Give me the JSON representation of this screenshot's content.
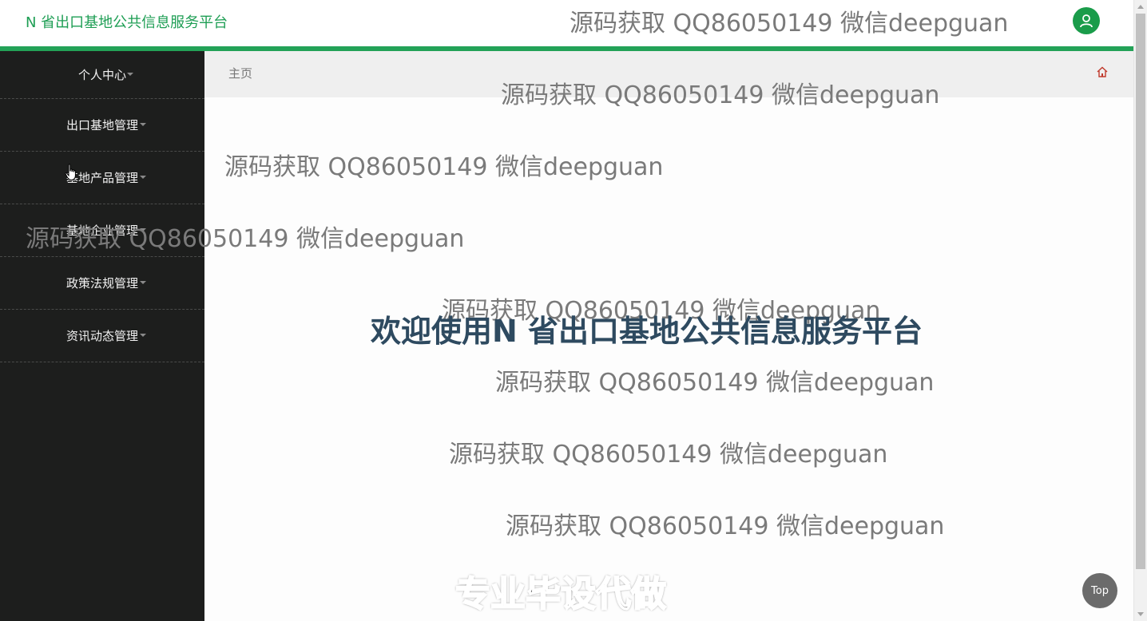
{
  "header": {
    "app_title": "N 省出口基地公共信息服务平台",
    "avatar_icon": "user-icon"
  },
  "sidebar": {
    "items": [
      {
        "label": "个人中心"
      },
      {
        "label": "出口基地管理"
      },
      {
        "label": "基地产品管理"
      },
      {
        "label": "基地企业管理"
      },
      {
        "label": "政策法规管理"
      },
      {
        "label": "资讯动态管理"
      }
    ]
  },
  "breadcrumb": {
    "label": "主页",
    "home_icon": "home-icon"
  },
  "main": {
    "welcome": "欢迎使用N 省出口基地公共信息服务平台",
    "watermark": "源码获取 QQ86050149 微信deepguan",
    "promo": "专业毕设代做"
  },
  "top_button": {
    "label": "Top"
  },
  "colors": {
    "brand_green": "#23a257",
    "sidebar_bg": "#1d1e1d",
    "welcome_text": "#2e4a60"
  }
}
